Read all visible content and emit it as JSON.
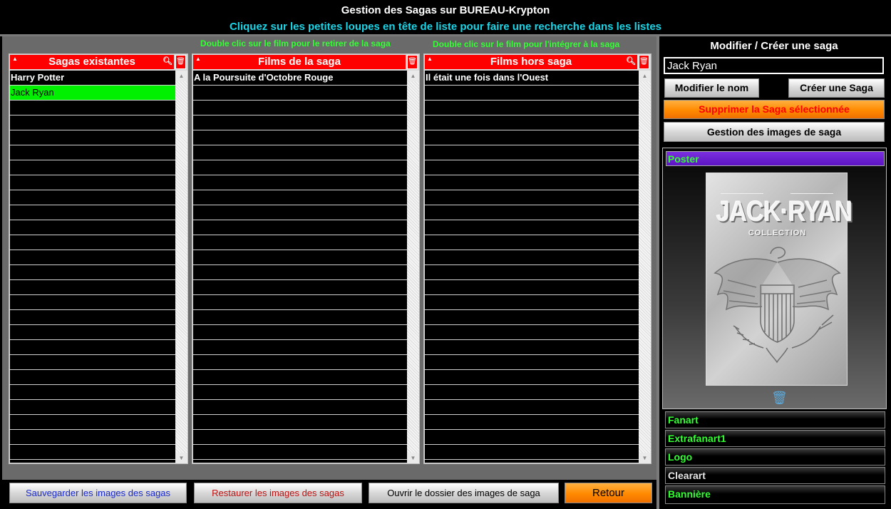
{
  "header": {
    "title": "Gestion des Sagas sur BUREAU-Krypton",
    "subtitle": "Cliquez sur les petites loupes en tête de liste pour faire une recherche dans les listes"
  },
  "hints": {
    "remove": "Double clic sur le film pour le retirer de la saga",
    "add": "Double clic sur le film pour l'intégrer à la saga"
  },
  "lists": {
    "sagas": {
      "header": "Sagas existantes",
      "items": [
        "Harry Potter",
        "Jack Ryan"
      ],
      "selected": "Jack Ryan"
    },
    "films_in_saga": {
      "header": "Films de la saga",
      "items": [
        "A la Poursuite d'Octobre Rouge"
      ]
    },
    "films_outside": {
      "header": "Films hors saga",
      "items": [
        "Il était une fois dans l'Ouest"
      ]
    }
  },
  "right_panel": {
    "title": "Modifier / Créer une saga",
    "name_value": "Jack Ryan",
    "rename_label": "Modifier le nom",
    "create_label": "Créer une Saga",
    "delete_label": "Supprimer la Saga sélectionnée",
    "images_label": "Gestion des images de saga",
    "poster_label": "Poster",
    "poster_title": "JACK·RYAN",
    "poster_subtitle": "COLLECTION",
    "image_categories": [
      "Fanart",
      "Extrafanart1",
      "Logo",
      "Clearart",
      "Bannière"
    ]
  },
  "bottom": {
    "save_label": "Sauvegarder les images des sagas",
    "restore_label": "Restaurer les images des sagas",
    "open_label": "Ouvrir le dossier des images de saga",
    "back_label": "Retour"
  },
  "colors": {
    "accent_red": "#ff0000",
    "selection_green": "#00f000",
    "hint_green": "#33ff33",
    "subtitle_cyan": "#19d5e8",
    "orange": "#ff8a00",
    "poster_bar_purple": "#6a1fd0",
    "delete_text_red": "#ff0000",
    "save_text_blue": "#1a2ad0",
    "restore_text_red": "#c01010"
  },
  "icons": {
    "sort": "sort-triangle-icon",
    "search": "magnifier-icon",
    "delete": "trash-icon"
  }
}
